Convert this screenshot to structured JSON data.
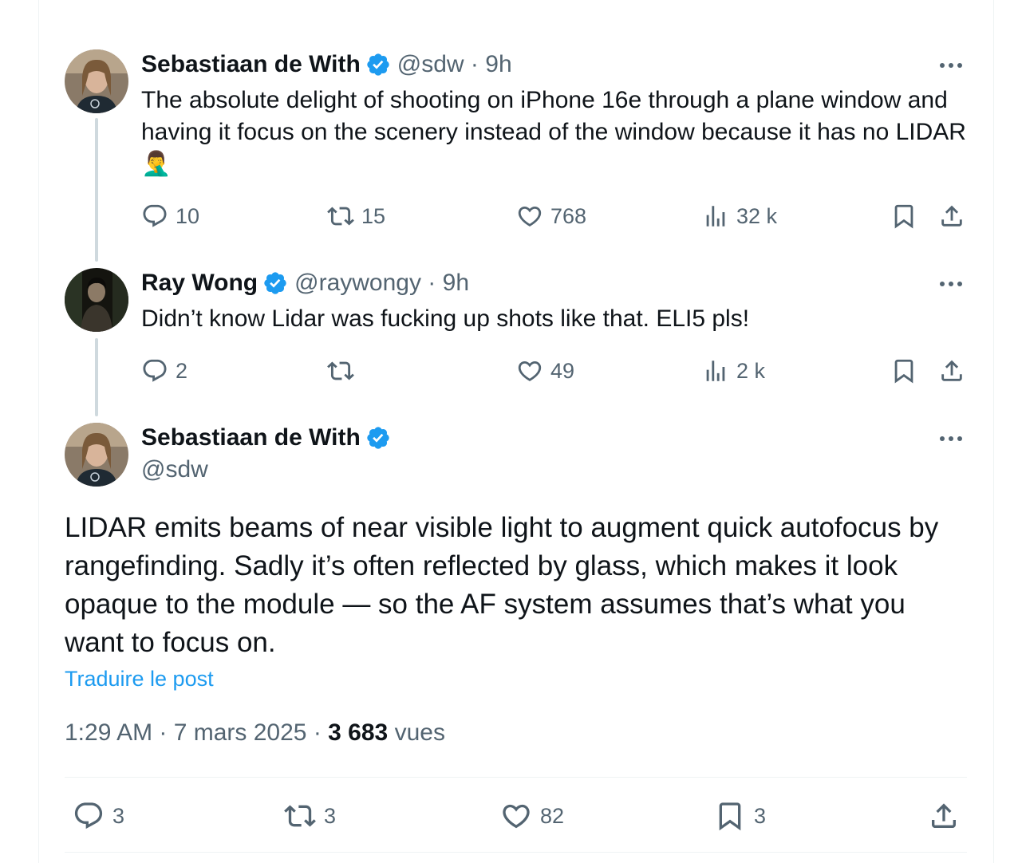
{
  "tweets": [
    {
      "name": "Sebastiaan de With",
      "meta": "@sdw · 9h",
      "text": "The absolute delight of shooting on iPhone 16e through a plane window and having it focus on the scenery instead of the window because it has no LIDAR 🤦‍♂️",
      "replies": "10",
      "reposts": "15",
      "likes": "768",
      "views": "32 k"
    },
    {
      "name": "Ray Wong",
      "meta": "@raywongy · 9h",
      "text": "Didn’t know Lidar was fucking up shots like that. ELI5 pls!",
      "replies": "2",
      "reposts": "",
      "likes": "49",
      "views": "2 k"
    }
  ],
  "main_tweet": {
    "name": "Sebastiaan de With",
    "handle": "@sdw",
    "text": "LIDAR emits beams of near visible light to augment quick autofocus by rangefinding. Sadly it’s often reflected by glass, which makes it look opaque to the module — so the AF system assumes that’s what you want to focus on.",
    "translate_label": "Traduire le post",
    "time_date": "1:29 AM · 7 mars 2025 · ",
    "views_count": "3 683",
    "views_label": " vues",
    "replies": "3",
    "reposts": "3",
    "likes": "82",
    "bookmarks": "3"
  },
  "colors": {
    "verified": "#1d9bf0",
    "secondary_text": "#536471",
    "link": "#1d9bf0",
    "thread_line": "#cfd9de"
  },
  "icons": [
    "reply-icon",
    "repost-icon",
    "like-icon",
    "views-icon",
    "bookmark-icon",
    "share-icon",
    "verified-badge-icon",
    "more-icon"
  ]
}
